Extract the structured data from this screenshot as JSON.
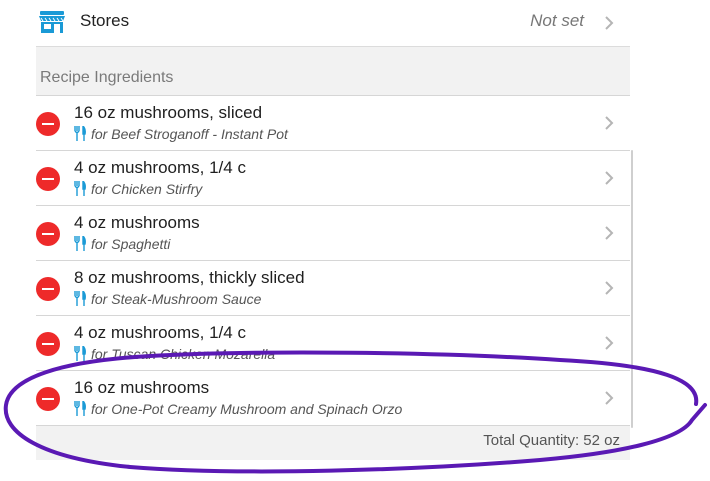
{
  "stores": {
    "label": "Stores",
    "value": "Not set"
  },
  "section": {
    "title": "Recipe Ingredients"
  },
  "ingredients": [
    {
      "name": "16 oz mushrooms, sliced",
      "recipe": "for Beef Stroganoff - Instant Pot"
    },
    {
      "name": "4 oz mushrooms, 1/4 c",
      "recipe": "for Chicken Stirfry"
    },
    {
      "name": "4 oz mushrooms",
      "recipe": "for Spaghetti"
    },
    {
      "name": "8 oz mushrooms, thickly sliced",
      "recipe": "for Steak-Mushroom Sauce"
    },
    {
      "name": "4 oz mushrooms, 1/4 c",
      "recipe": "for Tuscan Chicken Mozarella"
    },
    {
      "name": "16 oz mushrooms",
      "recipe": "for One-Pot Creamy Mushroom and Spinach Orzo"
    }
  ],
  "total": {
    "text": "Total Quantity: 52 oz"
  },
  "colors": {
    "accent_blue": "#1a9ad6",
    "delete_red": "#ee2a2a",
    "annotation_purple": "#5a19b4"
  },
  "icons": {
    "store": "storefront-icon",
    "delete": "minus-circle-icon",
    "recipe": "fork-knife-icon",
    "disclosure": "chevron-right-icon"
  }
}
